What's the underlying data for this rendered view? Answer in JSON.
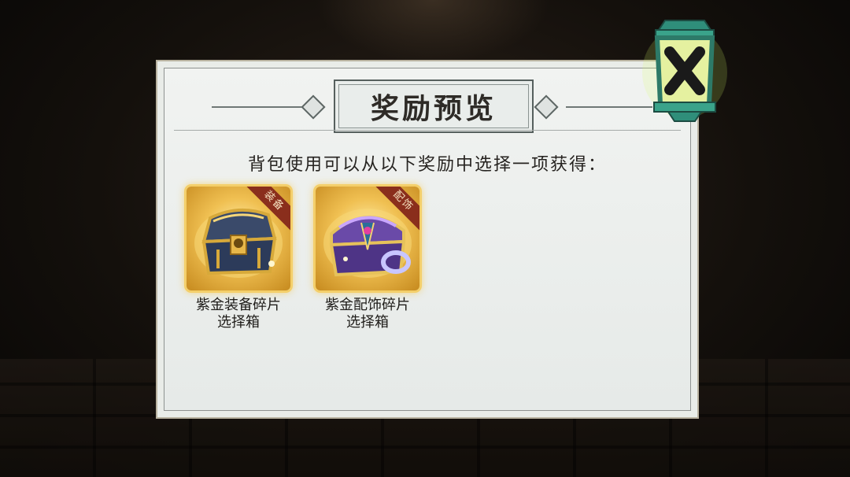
{
  "dialog": {
    "title": "奖励预览",
    "instruction": "背包使用可以从以下奖励中选择一项获得："
  },
  "rewards": [
    {
      "name_line1": "紫金装备碎片",
      "name_line2": "选择箱",
      "badge": "装备",
      "icon": "golden-equipment-chest-icon"
    },
    {
      "name_line1": "紫金配饰碎片",
      "name_line2": "选择箱",
      "badge": "配饰",
      "icon": "purple-accessory-chest-icon"
    }
  ],
  "close_button": {
    "icon": "lantern-close-icon"
  },
  "colors": {
    "panel": "#e9ece8",
    "badge": "#8a2e1c",
    "gold": "#f0c052",
    "lantern": "#3aa38a"
  }
}
